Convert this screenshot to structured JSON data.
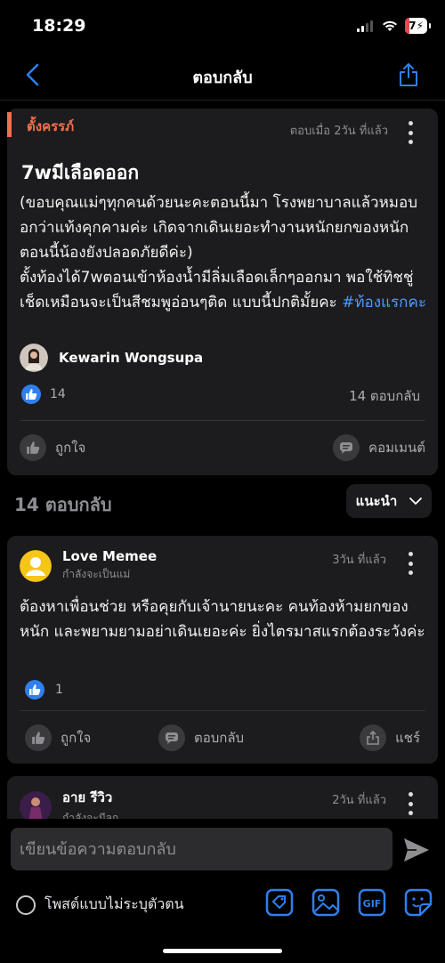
{
  "status": {
    "time": "18:29",
    "battery": "7"
  },
  "nav": {
    "title": "ตอบกลับ"
  },
  "post": {
    "tag": "ตั้งครรภ์",
    "time": "ตอบเมื่อ 2วัน ที่แล้ว",
    "title": "7wมีเลือดออก",
    "body": "(ขอบคุณแม่ๆทุกคนด้วยนะคะตอนนี้มา โรงพยาบาลแล้วหมอบอกว่าแท้งคุกคามค่ะ เกิดจากเดินเยอะทำงานหนักยกของหนัก ตอนนี้น้องยังปลอดภัยดีค่ะ)\nตั้งท้องได้7wตอนเข้าห้องน้ำมีลิ่มเลือดเล็กๆออกมา พอใช้ทิชชู่เช็ดเหมือนจะเป็นสีชมพูอ่อนๆติด แบบนี้ปกติมั้ยคะ ",
    "hashtag": "#ท้องแรกคะ",
    "author": "Kewarin Wongsupa",
    "likes": "14",
    "replies": "14 ตอบกลับ",
    "like_label": "ถูกใจ",
    "comment_label": "คอมเมนต์"
  },
  "replies_section": {
    "title": "14 ตอบกลับ",
    "sort": "แนะนำ"
  },
  "comments": [
    {
      "name": "Love Memee",
      "status": "กำลังจะเป็นแม่",
      "time": "3วัน ที่แล้ว",
      "body": "ต้องหาเพื่อนช่วย หรือคุยกับเจ้านายนะคะ คนท้องห้ามยกของหนัก และพยามยามอย่าเดินเยอะค่ะ ยิ่งไตรมาสแรกต้องระวังค่ะ",
      "likes": "1",
      "like_label": "ถูกใจ",
      "reply_label": "ตอบกลับ",
      "share_label": "แชร์"
    },
    {
      "name": "อาย รีวิว",
      "status": "กำลังจะมีลูก",
      "time": "2วัน ที่แล้ว"
    }
  ],
  "composer": {
    "placeholder": "เขียนข้อความตอบกลับ",
    "anonymous_label": "โพสต์แบบไม่ระบุตัวตน",
    "gif_label": "GIF"
  },
  "colors": {
    "accent": "#2f80ed",
    "tag": "#f26f4c",
    "card": "#1c1c1e"
  }
}
